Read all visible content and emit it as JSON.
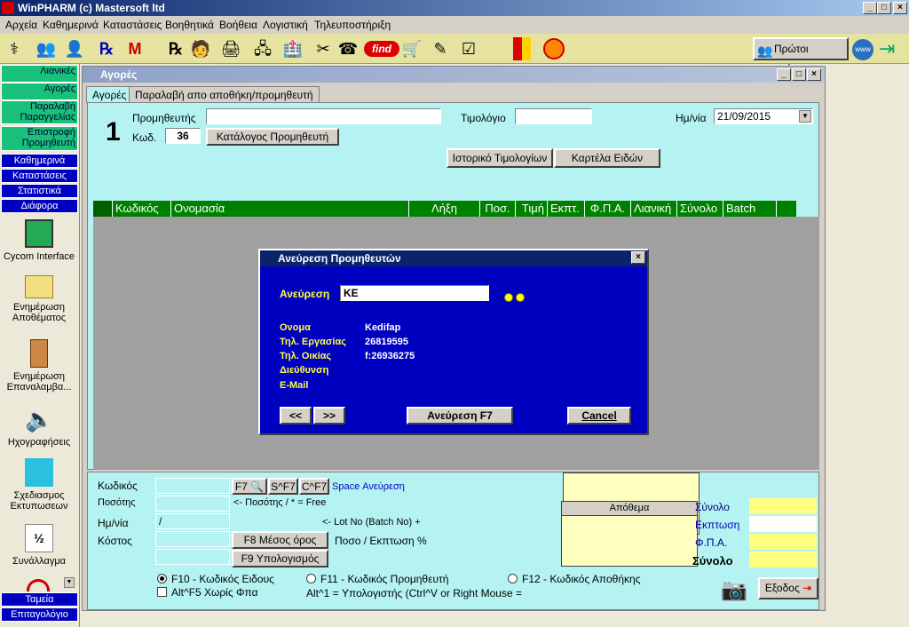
{
  "window": {
    "title": "WinPHARM (c) Mastersoft ltd"
  },
  "menu": [
    "Αρχεία",
    "Καθημερινά",
    "Καταστάσεις",
    "Βοηθητικά",
    "Βοήθεια",
    "Λογιστική",
    "Τηλευποστήριξη"
  ],
  "toolbar": {
    "first_users_label": "Πρώτοι χρήστες",
    "find_label": "find"
  },
  "sidebar": {
    "green_items": [
      "Λιανικές",
      "Αγορές",
      "Παραλαβή Παραγγελίας",
      "Επιστροφή Προμηθευτή"
    ],
    "blue_items": [
      "Καθημερινά",
      "Καταστάσεις",
      "Στατιστικά",
      "Διάφορα"
    ],
    "tools": [
      "Cycom Interface",
      "Ενημέρωση Αποθέματος",
      "Ενημέρωση Επαναλαμβα...",
      "Ηχογραφήσεις",
      "Σχεδιασμος Εκτυπωσεων",
      "Συνάλλαγμα"
    ],
    "bottom_items": [
      "Ταμεία",
      "Επιταγολόγιο"
    ]
  },
  "main": {
    "title": "Αγορές",
    "tabs": [
      "Αγορές",
      "Παραλαβή απο αποθήκη/προμηθευτή"
    ],
    "number": "1",
    "supplier_label": "Προμηθευτής",
    "code_label": "Κωδ.",
    "code_value": "36",
    "supplier_list_button": "Κατάλογος Προμηθευτή",
    "invoice_label": "Τιμολόγιο",
    "date_label": "Ημ/νία",
    "date_value": "21/09/2015",
    "history_button": "Ιστορικό Τιμολογίων",
    "items_card_button": "Καρτέλα Ειδών",
    "grid_columns": [
      "Κωδικός",
      "Ονομασία",
      "Λήξη",
      "Ποσ.",
      "Τιμή",
      "Εκπτ.",
      "Φ.Π.Α.",
      "Λιανική",
      "Σύνολο",
      "Batch"
    ]
  },
  "dialog": {
    "title": "Ανεύρεση Προμηθευτών",
    "search_label": "Ανεύρεση",
    "search_value": "KE",
    "fields": [
      {
        "label": "Ονομα",
        "value": "Kedifap"
      },
      {
        "label": "Τηλ. Εργασίας",
        "value": "26819595"
      },
      {
        "label": "Τηλ. Οικίας",
        "value": "f:26936275"
      },
      {
        "label": "Διεύθυνση",
        "value": ""
      },
      {
        "label": "E-Mail",
        "value": ""
      }
    ],
    "prev_button": "<<",
    "next_button": ">>",
    "search_button": "Ανεύρεση F7",
    "cancel_button": "Cancel"
  },
  "bottom": {
    "code_label": "Κωδικός",
    "qty_label": "Ποσότης",
    "date_label": "Ημ/νία",
    "cost_label": "Κόστος",
    "date_value": "/",
    "f7_button": "F7",
    "sf7_button": "S^F7",
    "cf7_button": "C^F7",
    "space_search": "Space Ανεύρεση",
    "qty_hint": "<-  Ποσότης / * = Free",
    "lot_hint": "<-  Lot No (Batch No) +",
    "f8_button": "F8 Μέσος όρος",
    "f9_button": "F9 Υπολογισμός",
    "pct_hint": "Ποσο / Εκπτωση %",
    "stock_label": "Απόθεμα",
    "radio1": "F10 - Κωδικός Ειδους",
    "radio2": "F11 - Κωδικός Προμηθευτή",
    "radio3": "F12 - Κωδικός Αποθήκης",
    "check1": "Alt^F5 Χωρίς Φπα",
    "calc_hint": "Alt^1 = Υπολογιστής (Ctrl^V or Right Mouse =",
    "total_label": "Σύνολο",
    "discount_label": "Εκπτωση",
    "vat_label": "Φ.Π.Α.",
    "grand_total_label": "Σύνολο",
    "exit_button": "Εξοδος"
  }
}
